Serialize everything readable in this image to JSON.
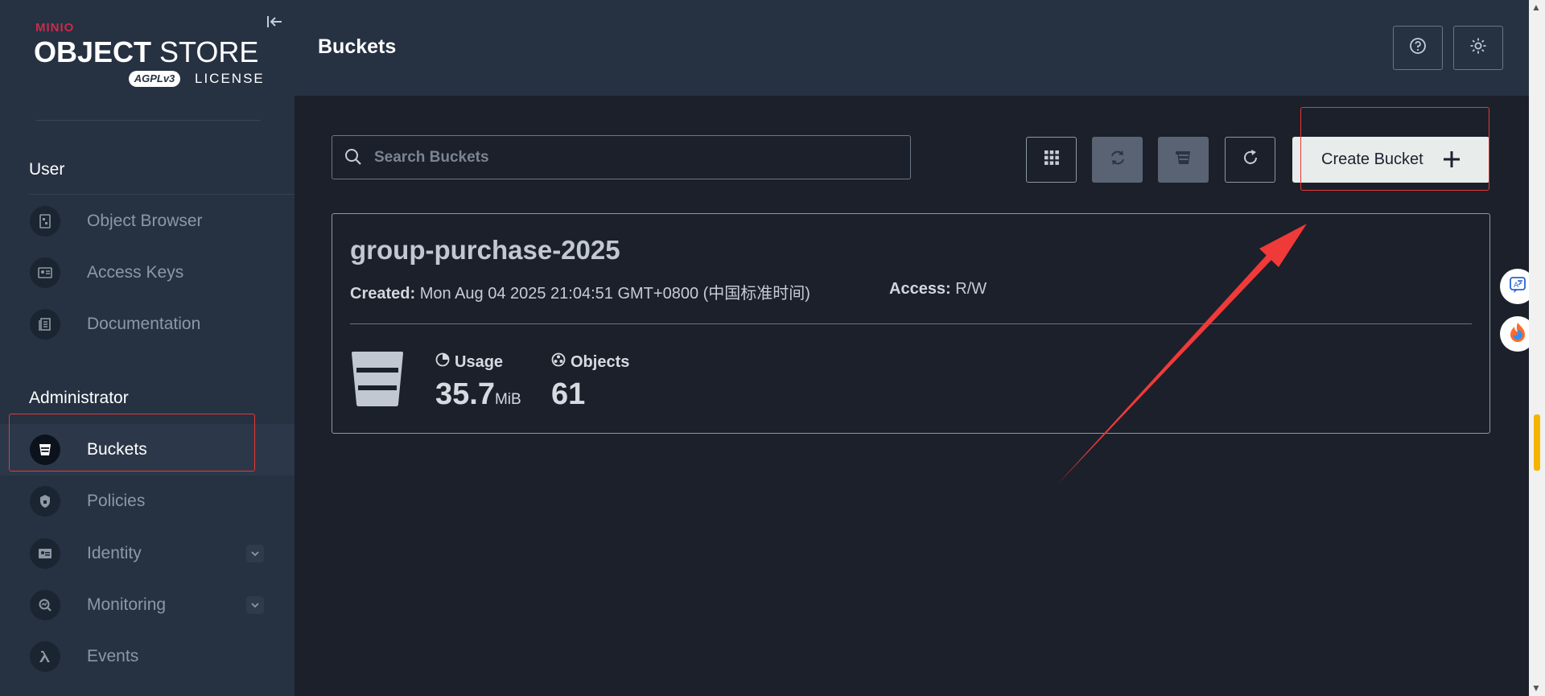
{
  "logo": {
    "brand": "MINIO",
    "product_line1": "OBJECT",
    "product_line2": "STORE",
    "license_badge": "AGPLv3",
    "license": "LICENSE"
  },
  "sidebar": {
    "user_title": "User",
    "user_items": [
      {
        "label": "Object Browser",
        "icon": "object-browser-icon"
      },
      {
        "label": "Access Keys",
        "icon": "access-keys-icon"
      },
      {
        "label": "Documentation",
        "icon": "documentation-icon"
      }
    ],
    "admin_title": "Administrator",
    "admin_items": [
      {
        "label": "Buckets",
        "icon": "bucket-icon",
        "active": true
      },
      {
        "label": "Policies",
        "icon": "policy-icon"
      },
      {
        "label": "Identity",
        "icon": "identity-icon",
        "expandable": true
      },
      {
        "label": "Monitoring",
        "icon": "monitoring-icon",
        "expandable": true
      },
      {
        "label": "Events",
        "icon": "lambda-icon"
      }
    ]
  },
  "header": {
    "title": "Buckets",
    "help_icon": "help-icon",
    "theme_icon": "sun-icon"
  },
  "search": {
    "placeholder": "Search Buckets",
    "value": ""
  },
  "toolbar": {
    "create_label": "Create Bucket"
  },
  "bucket": {
    "name": "group-purchase-2025",
    "created_label": "Created:",
    "created_value": "Mon Aug 04 2025 21:04:51 GMT+0800 (中国标准时间)",
    "access_label": "Access:",
    "access_value": "R/W",
    "usage_label": "Usage",
    "usage_value": "35.7",
    "usage_unit": "MiB",
    "objects_label": "Objects",
    "objects_value": "61"
  },
  "colors": {
    "sidebar_bg": "#263142",
    "main_bg": "#1c202a",
    "highlight": "#e53935",
    "arrow": "#f03a3a"
  }
}
